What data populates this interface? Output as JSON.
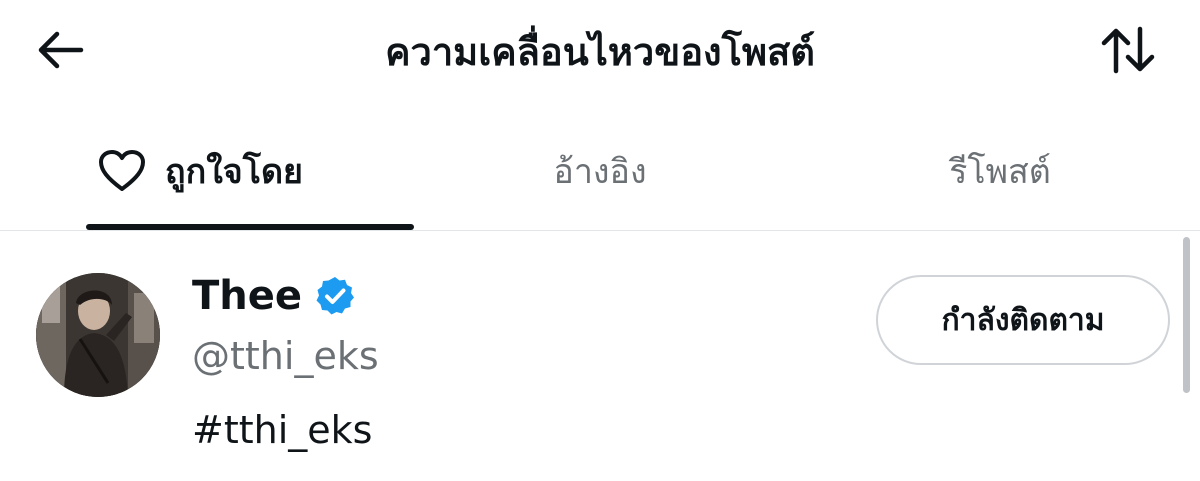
{
  "header": {
    "title": "ความเคลื่อนไหวของโพสต์",
    "back_icon": "back-arrow-icon",
    "sort_icon": "sort-arrows-icon"
  },
  "tabs": [
    {
      "label": "ถูกใจโดย",
      "active": true,
      "icon": "heart-icon"
    },
    {
      "label": "อ้างอิง",
      "active": false
    },
    {
      "label": "รีโพสต์",
      "active": false
    }
  ],
  "user": {
    "display_name": "Thee",
    "verified": true,
    "handle": "@tthi_eks",
    "bio": "#tthi_eks",
    "follow_label": "กำลังติดตาม"
  },
  "colors": {
    "text_primary": "#0f1419",
    "text_secondary": "#6b7075",
    "verified_blue": "#1d9bf0",
    "border": "#d0d4d8"
  }
}
